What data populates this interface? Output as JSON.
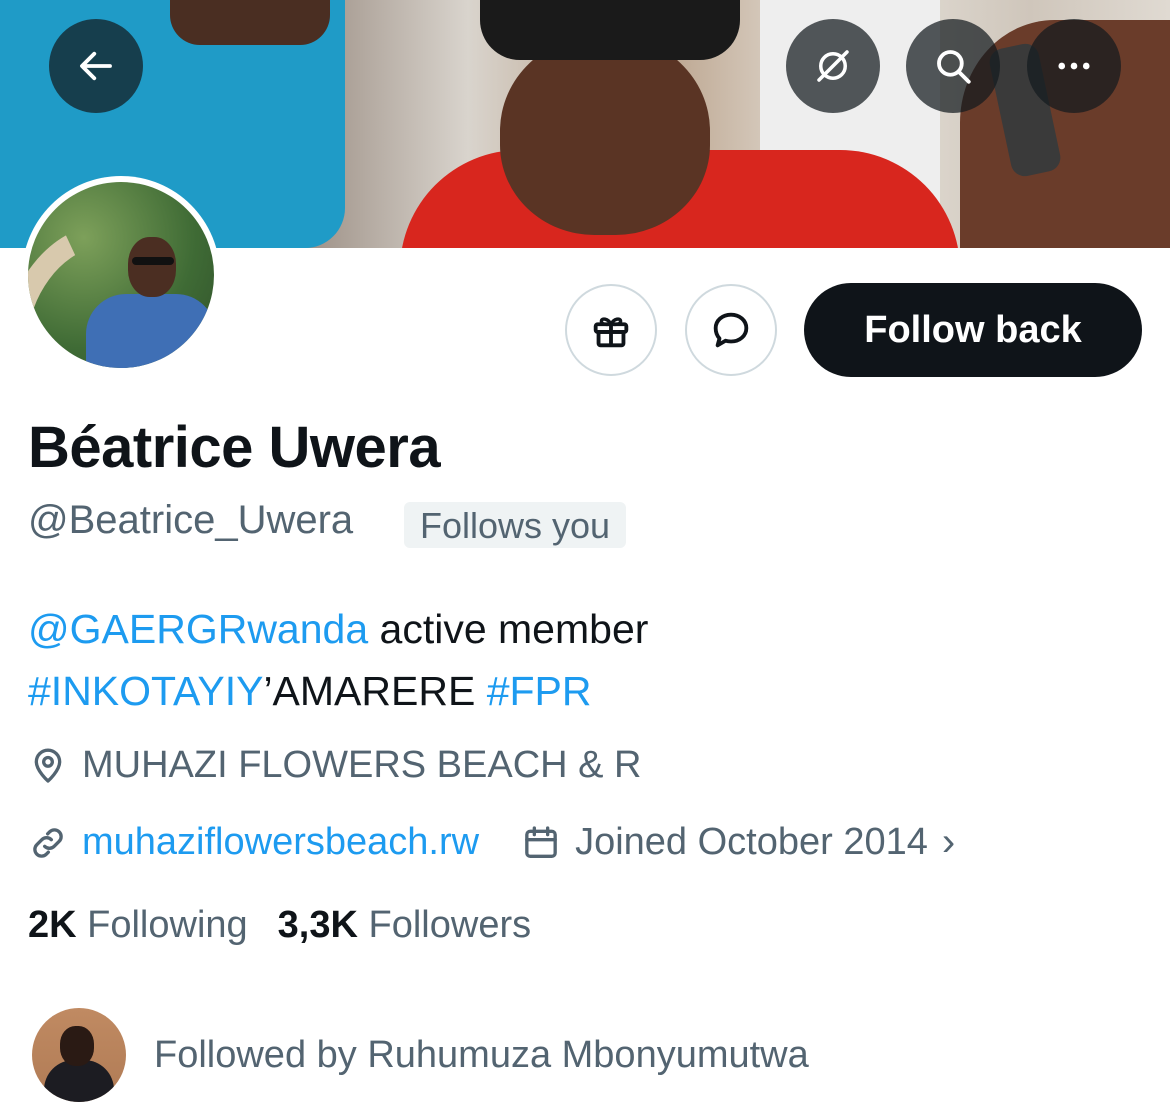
{
  "header": {
    "back_icon": "arrow-left-icon",
    "grok_icon": "grok-icon",
    "search_icon": "search-icon",
    "more_icon": "more-horizontal-icon"
  },
  "actions": {
    "gift_icon": "gift-icon",
    "message_icon": "message-bubble-icon",
    "follow_label": "Follow back"
  },
  "profile": {
    "name": "Béatrice Uwera",
    "handle": "@Beatrice_Uwera",
    "follows_you": "Follows you",
    "bio": {
      "mention": "@GAERGRwanda",
      "line1_rest": " active member",
      "hashtag1": "#INKOTAYIY",
      "line2_mid": "’AMARERE ",
      "hashtag2": "#FPR"
    },
    "location": "MUHAZI FLOWERS BEACH & R",
    "website": "muhaziflowersbeach.rw",
    "joined": "Joined October 2014",
    "joined_chevron": "›"
  },
  "stats": {
    "following_count": "2K",
    "following_label": "Following",
    "followers_count": "3,3K",
    "followers_label": "Followers"
  },
  "followed_by": {
    "text": "Followed by Ruhumuza Mbonyumutwa"
  },
  "colors": {
    "link": "#1d9bf0",
    "secondary_text": "#536471",
    "primary_text": "#0f1419",
    "button_dark": "#0f1419"
  }
}
